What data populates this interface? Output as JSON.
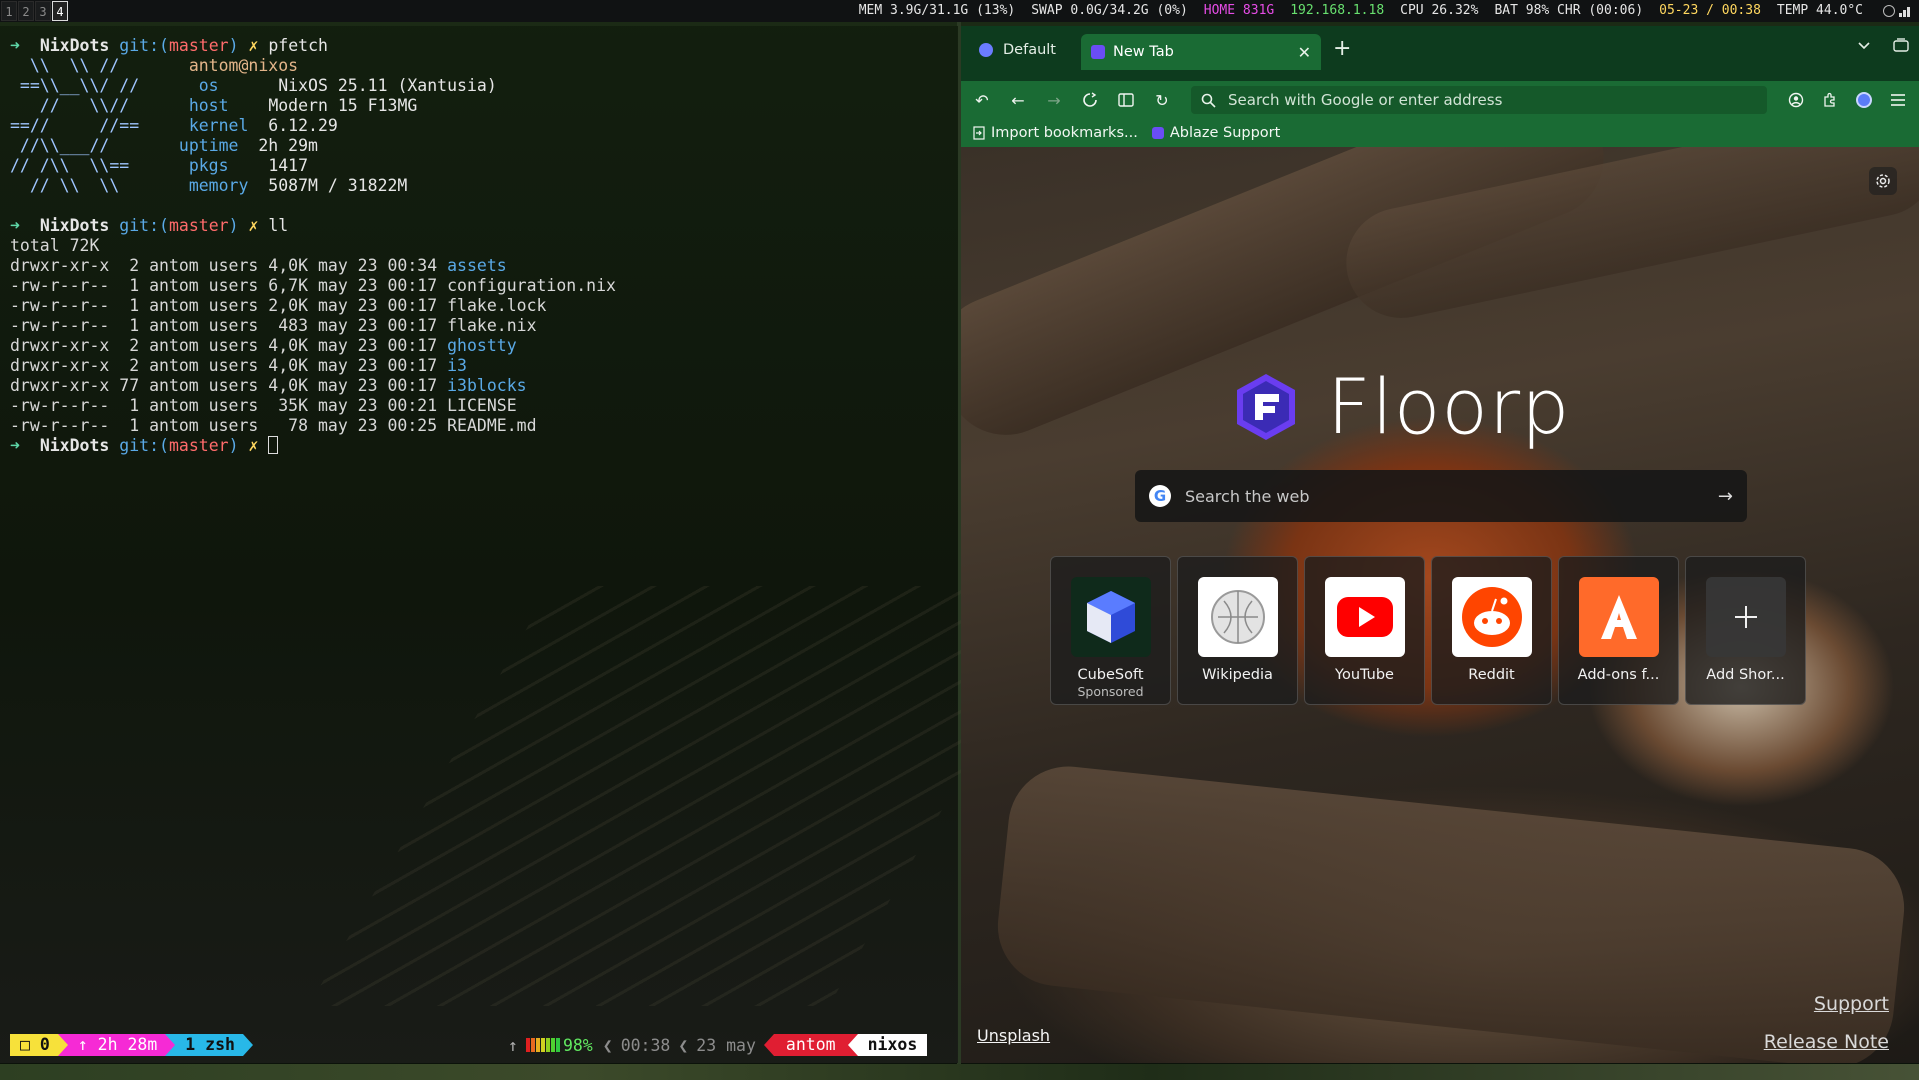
{
  "topbar": {
    "workspaces": [
      "1",
      "2",
      "3",
      "4"
    ],
    "active_workspace": "4",
    "blocks": {
      "mem": "MEM 3.9G/31.1G (13%)",
      "swap": "SWAP 0.0G/34.2G (0%)",
      "home": "HOME 831G",
      "ip": "192.168.1.18",
      "cpu": "CPU 26.32%",
      "bat": "BAT 98% CHR (00:06)",
      "datetime": "05-23 / 00:38",
      "temp": "TEMP 44.0°C"
    },
    "colors": {
      "home": "#e64ce6",
      "ip": "#68e06f",
      "datetime": "#ffd75f",
      "default": "#e6e6e6"
    }
  },
  "terminal": {
    "prompt": {
      "arrow": "➜",
      "dir": "NixDots",
      "git": "git:(",
      "branch": "master",
      "git_close": ")",
      "x": "✗"
    },
    "cmd1": "pfetch",
    "pfetch": {
      "logo": [
        "  \\\\  \\\\ //  ",
        " ==\\\\__\\\\/ // ",
        "   //   \\\\// ",
        "==//     //==",
        " //\\\\___//  ",
        "// /\\\\  \\\\== ",
        "  // \\\\  \\\\  "
      ],
      "title": "antom@nixos",
      "rows": [
        {
          "key": "os",
          "value": "NixOS 25.11 (Xantusia)"
        },
        {
          "key": "host",
          "value": "Modern 15 F13MG"
        },
        {
          "key": "kernel",
          "value": "6.12.29"
        },
        {
          "key": "uptime",
          "value": "2h 29m"
        },
        {
          "key": "pkgs",
          "value": "1417"
        },
        {
          "key": "memory",
          "value": "5087M / 31822M"
        }
      ]
    },
    "cmd2": "ll",
    "total": "total 72K",
    "listing": [
      {
        "meta": "drwxr-xr-x  2 antom users 4,0K may 23 00:34 ",
        "name": "assets",
        "dir": true
      },
      {
        "meta": "-rw-r--r--  1 antom users 6,7K may 23 00:17 ",
        "name": "configuration.nix",
        "dir": false
      },
      {
        "meta": "-rw-r--r--  1 antom users 2,0K may 23 00:17 ",
        "name": "flake.lock",
        "dir": false
      },
      {
        "meta": "-rw-r--r--  1 antom users  483 may 23 00:17 ",
        "name": "flake.nix",
        "dir": false
      },
      {
        "meta": "drwxr-xr-x  2 antom users 4,0K may 23 00:17 ",
        "name": "ghostty",
        "dir": true
      },
      {
        "meta": "drwxr-xr-x  2 antom users 4,0K may 23 00:17 ",
        "name": "i3",
        "dir": true
      },
      {
        "meta": "drwxr-xr-x 77 antom users 4,0K may 23 00:17 ",
        "name": "i3blocks",
        "dir": true
      },
      {
        "meta": "-rw-r--r--  1 antom users  35K may 23 00:21 ",
        "name": "LICENSE",
        "dir": false
      },
      {
        "meta": "-rw-r--r--  1 antom users   78 may 23 00:25 ",
        "name": "README.md",
        "dir": false
      }
    ],
    "status": {
      "seg_a": "□ 0",
      "seg_b": "↑ 2h 28m",
      "seg_c": "1 zsh",
      "up_arrow": "↑",
      "battery_pct": "98%",
      "time": "00:38",
      "date": "23 may",
      "user": "antom",
      "host": "nixos",
      "sep": "❮"
    }
  },
  "browser": {
    "tabs": [
      {
        "label": "Default"
      },
      {
        "label": "New Tab",
        "close": "✕"
      }
    ],
    "new_tab_btn": "+",
    "nav": {
      "back_icon": "←",
      "forward_icon": "→",
      "reload_icon": "↻",
      "undo_icon": "↶",
      "url_placeholder": "Search with Google or enter address"
    },
    "bookmarks": [
      {
        "label": "Import bookmarks..."
      },
      {
        "label": "Ablaze Support"
      }
    ],
    "page": {
      "brand": "Floorp",
      "search_placeholder": "Search the web",
      "shortcuts": [
        {
          "name": "CubeSoft",
          "sub": "Sponsored"
        },
        {
          "name": "Wikipedia",
          "sub": ""
        },
        {
          "name": "YouTube",
          "sub": ""
        },
        {
          "name": "Reddit",
          "sub": ""
        },
        {
          "name": "Add-ons f...",
          "sub": ""
        },
        {
          "name": "Add Shor...",
          "sub": ""
        }
      ],
      "unsplash": "Unsplash",
      "support": "Support",
      "release_note": "Release Note"
    }
  }
}
